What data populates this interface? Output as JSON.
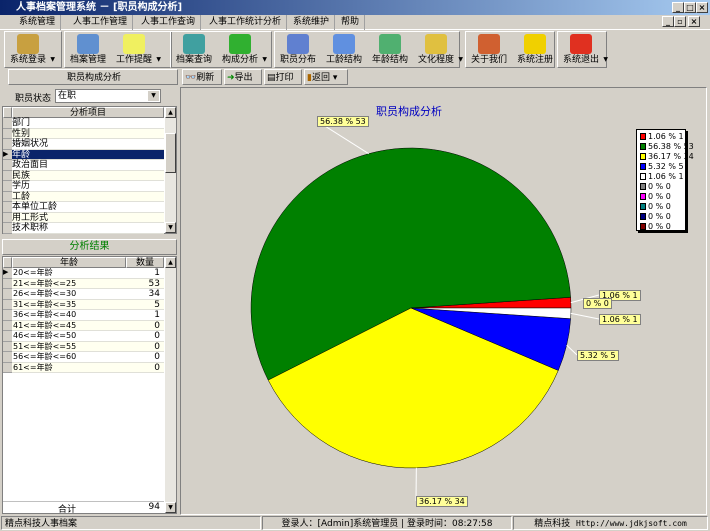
{
  "window": {
    "title": "人事档案管理系统 － [职员构成分析]"
  },
  "menu": [
    "系统管理",
    "人事工作管理",
    "人事工作查询",
    "人事工作统计分析",
    "系统维护",
    "帮助"
  ],
  "toolbar": [
    "系统登录",
    "档案管理",
    "工作提醒",
    "档案查询",
    "构成分析",
    "职员分布",
    "工龄结构",
    "年龄结构",
    "文化程度",
    "关于我们",
    "系统注册",
    "系统退出"
  ],
  "subbar": {
    "panel_title": "职员构成分析",
    "refresh": "刷新",
    "export": "导出",
    "print": "打印",
    "back": "返回"
  },
  "filter": {
    "label": "职员状态",
    "value": "在职"
  },
  "items": {
    "header": "分析项目",
    "rows": [
      "部门",
      "性别",
      "婚姻状况",
      "年龄",
      "政治面目",
      "民族",
      "学历",
      "工龄",
      "本单位工龄",
      "用工形式",
      "技术职称"
    ],
    "selected": "年龄"
  },
  "results": {
    "title": "分析结果",
    "col1": "年龄",
    "col2": "数量",
    "rows": [
      [
        "20<=年龄",
        "1"
      ],
      [
        "21<=年龄<=25",
        "53"
      ],
      [
        "26<=年龄<=30",
        "34"
      ],
      [
        "31<=年龄<=35",
        "5"
      ],
      [
        "36<=年龄<=40",
        "1"
      ],
      [
        "41<=年龄<=45",
        "0"
      ],
      [
        "46<=年龄<=50",
        "0"
      ],
      [
        "51<=年龄<=55",
        "0"
      ],
      [
        "56<=年龄<=60",
        "0"
      ],
      [
        "61<=年龄",
        "0"
      ]
    ],
    "total_label": "合计",
    "total": "94"
  },
  "chart_data": {
    "type": "pie",
    "title": "职员构成分析",
    "slices": [
      {
        "label": "1.06 % 1",
        "value": 1,
        "color": "#ff0000"
      },
      {
        "label": "56.38 % 53",
        "value": 53,
        "color": "#008000"
      },
      {
        "label": "36.17 % 34",
        "value": 34,
        "color": "#ffff00"
      },
      {
        "label": "5.32 % 5",
        "value": 5,
        "color": "#0000ff"
      },
      {
        "label": "1.06 % 1",
        "value": 1,
        "color": "#ffffff"
      },
      {
        "label": "0 % 0",
        "value": 0,
        "color": "#808080"
      },
      {
        "label": "0 % 0",
        "value": 0,
        "color": "#ff00ff"
      },
      {
        "label": "0 % 0",
        "value": 0,
        "color": "#008080"
      },
      {
        "label": "0 % 0",
        "value": 0,
        "color": "#000080"
      },
      {
        "label": "0 % 0",
        "value": 0,
        "color": "#800000"
      }
    ],
    "extra_label": "0 % 0",
    "legend": "right"
  },
  "status": {
    "app": "精点科技人事档案",
    "user": "登录人：[Admin]系统管理员",
    "sep": "|",
    "time": "登录时间：08:27:58",
    "company": "精点科技",
    "url": "Http://www.jdkjsoft.com"
  }
}
